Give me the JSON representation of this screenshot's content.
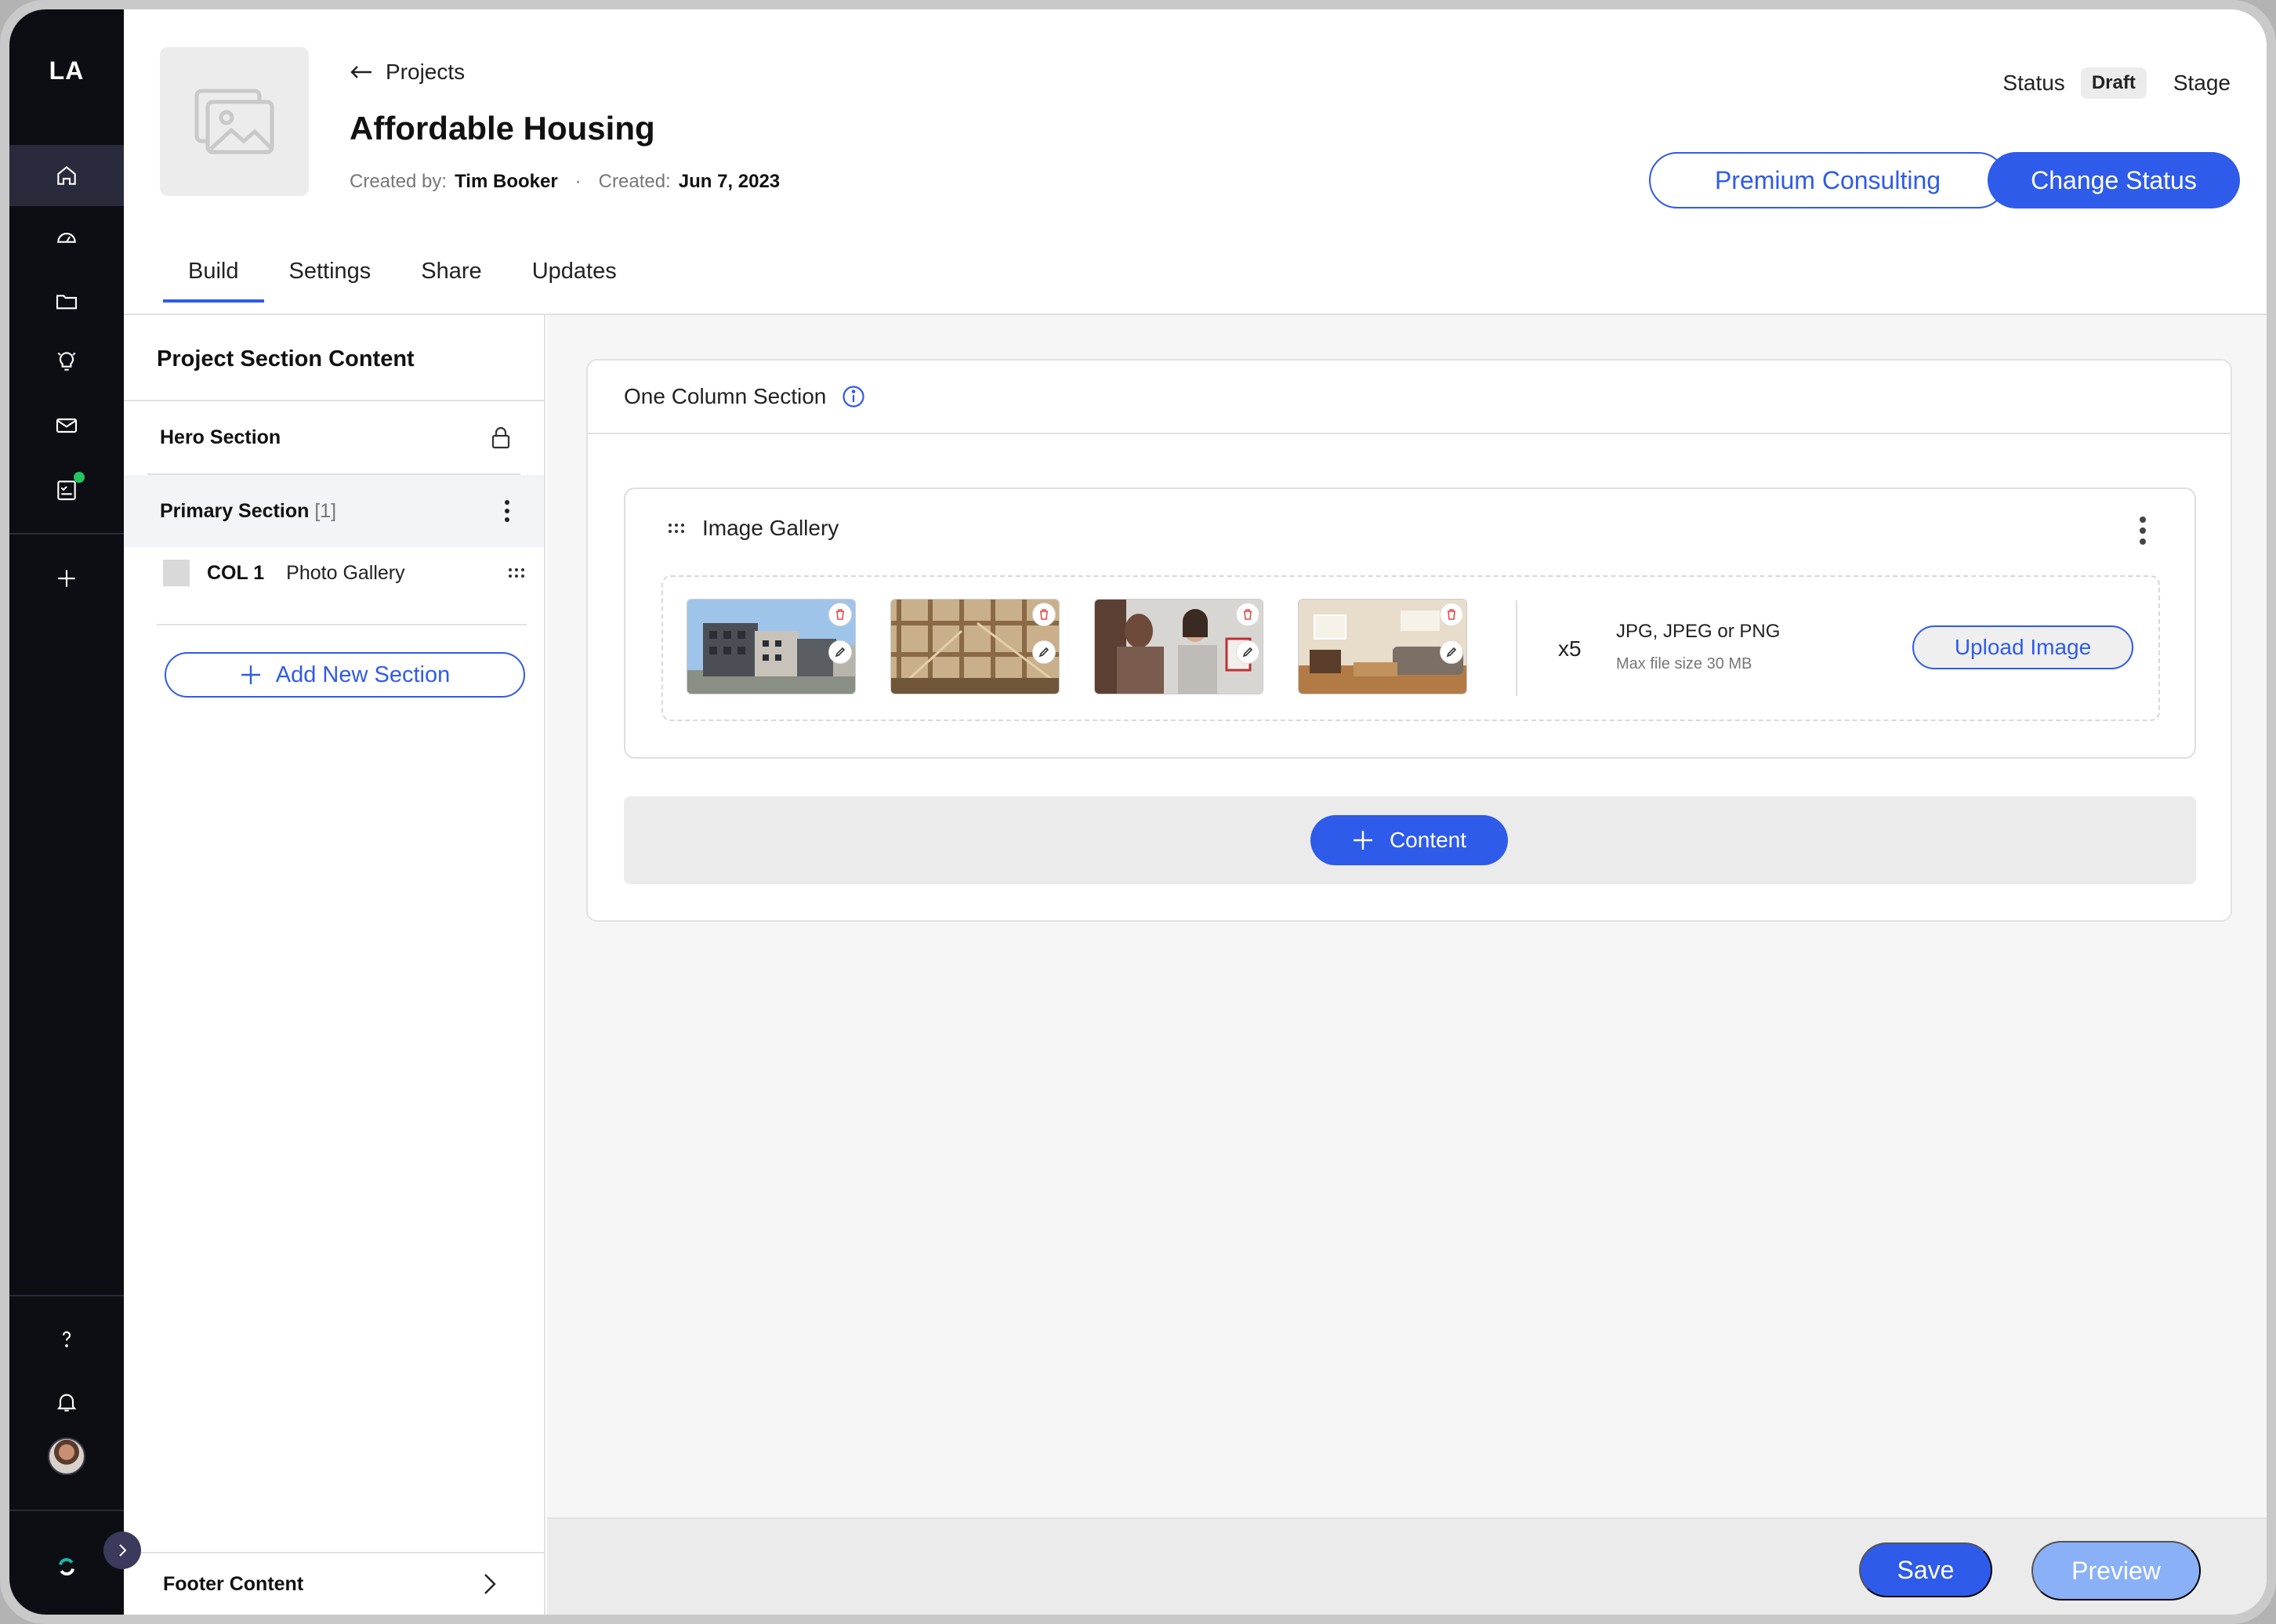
{
  "rail": {
    "logo": "LA",
    "icons": [
      "home-icon",
      "dashboard-icon",
      "folder-icon",
      "lightbulb-icon",
      "mail-icon",
      "checklist-icon",
      "plus-icon",
      "help-icon",
      "bell-icon",
      "avatar",
      "brand-icon",
      "chevron-right-icon"
    ]
  },
  "header": {
    "back_label": "Projects",
    "title": "Affordable Housing",
    "created_by_label": "Created by:",
    "created_by": "Tim Booker",
    "dot": "·",
    "created_label": "Created:",
    "created_date": "Jun 7, 2023",
    "status_label": "Status",
    "status_value": "Draft",
    "stage_label": "Stage",
    "premium_button": "Premium Consulting",
    "change_status_button": "Change Status"
  },
  "tabs": [
    "Build",
    "Settings",
    "Share",
    "Updates"
  ],
  "panel": {
    "title": "Project Section Content",
    "hero": "Hero Section",
    "primary": "Primary Section",
    "primary_count": "[1]",
    "col_label": "COL 1",
    "col_content": "Photo Gallery",
    "add_section": "Add New Section",
    "footer": "Footer Content"
  },
  "main": {
    "section_title": "One Column Section",
    "gallery_title": "Image Gallery",
    "count": "x5",
    "formats": "JPG, JPEG or PNG",
    "max_size": "Max file size 30 MB",
    "upload_button": "Upload Image",
    "content_button": "Content",
    "save_button": "Save",
    "preview_button": "Preview"
  },
  "colors": {
    "accent": "#2f5bea",
    "rail_bg": "#0d0d14",
    "preview_disabled": "#8ab0f7",
    "notify_dot": "#22c55e"
  }
}
